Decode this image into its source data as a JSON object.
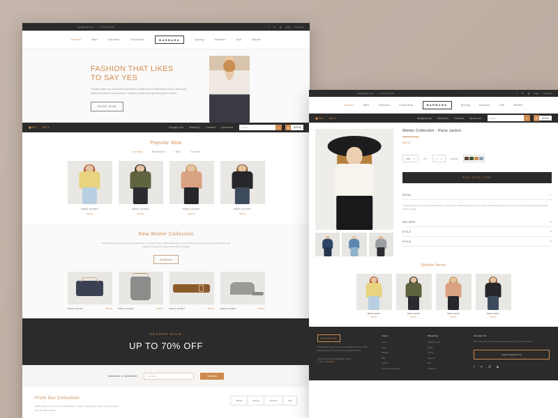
{
  "header": {
    "email": "gaia@zaid.com",
    "phone": "+1 212 475 00",
    "social_icons": [
      "facebook-icon",
      "twitter-icon",
      "google-plus-icon"
    ],
    "login": "Login",
    "register": "Register",
    "logo": "BARBARA",
    "nav": [
      {
        "label": "Women",
        "active": true
      },
      {
        "label": "Men",
        "active": false
      },
      {
        "label": "Children",
        "active": false
      },
      {
        "label": "Collection",
        "active": false
      },
      {
        "label": "Spring",
        "active": false
      },
      {
        "label": "Summer",
        "active": false
      },
      {
        "label": "Fall",
        "active": false
      },
      {
        "label": "Winter",
        "active": false
      }
    ],
    "language": "EN",
    "currency": "USD",
    "util_links": [
      "Shopping Cart",
      "Wishlist (0)",
      "Checkout",
      "My Account"
    ],
    "search_placeholder": "Search",
    "cart_total": "$79.00"
  },
  "hero": {
    "title_line1": "FASHION THAT LIKES",
    "title_line2": "TO SAY YES",
    "paragraph": "Curabitur neque erat, accumsan id imperdiet et, porttitor at sem. Pellentesque dum sit amet quam vehicula elementum sed sit amet dui. Vivamus suscipit tortor eget felis porttitor volutpat.",
    "cta": "SHOP NOW"
  },
  "popular": {
    "heading": "Popular Now",
    "filters": [
      {
        "label": "Trending",
        "active": true
      },
      {
        "label": "Bestsellers",
        "active": false
      },
      {
        "label": "New",
        "active": false
      },
      {
        "label": "On Sale",
        "active": false
      }
    ],
    "products": [
      {
        "name": "PARIS JACKET",
        "price": "$65.99",
        "top": "#e8d37f",
        "bottom": "#b7cfe0",
        "hair": "#b5542a"
      },
      {
        "name": "PARIS JACKET",
        "price": "$65.99",
        "top": "#5f6340",
        "bottom": "#2c2c30",
        "hair": "#3a2c23"
      },
      {
        "name": "PARIS JACKET",
        "price": "$69.99",
        "top": "#d9a283",
        "bottom": "#26262b",
        "hair": "#c79a58"
      },
      {
        "name": "PARIS JACKET",
        "price": "$65.99",
        "top": "#26262b",
        "bottom": "#3e4a5e",
        "hair": "#8f5c32"
      }
    ]
  },
  "winter": {
    "heading": "New Winter Collection",
    "paragraph": "Curabitur neque erat, accumsan id imperdiet et, porttitor at sem. Pellentesque dum sit amet quam vehicula elementum sed sit amet dui. Vivamus suscipit tortor eget felis porttitor volutpat.",
    "cta": "All collection",
    "accessories": [
      {
        "name": "PARIS JACKET",
        "price": "$65.99",
        "icon": "handbag-icon"
      },
      {
        "name": "PARIS JACKET",
        "price": "$65.99",
        "icon": "backpack-icon"
      },
      {
        "name": "PARIS JACKET",
        "price": "$65.99",
        "icon": "belt-icon"
      },
      {
        "name": "PARIS JACKET",
        "price": "$65.99",
        "icon": "cap-icon"
      }
    ]
  },
  "sale": {
    "kicker": "SEASON SALE",
    "headline": "UP TO 70% OFF"
  },
  "newsletter": {
    "label": "Subscribe to Newsletter",
    "placeholder": "Your Mail",
    "button": "Subscribe"
  },
  "collection": {
    "heading": "From Our Collection",
    "paragraph": "Pellentesque in ipsum id orci porta dapibus. Vivamus magna justo, lacinia eget consectetur sed, convallis at tellus.",
    "tabs": [
      "Winter",
      "Spring",
      "Summer",
      "Fall"
    ]
  },
  "pdp": {
    "title": "Winter Collection - Paris Jacket",
    "price": "$69.99",
    "size_label": "SIZE",
    "qty_label": "QTY",
    "qty_value": "1",
    "color_label": "COLOR",
    "swatches": [
      "#5c4634",
      "#3f5a2b",
      "#c98c4e",
      "#8ba2b8"
    ],
    "buy_button": "BUY THIS ITEM",
    "accordion": [
      {
        "title": "DETAIL",
        "state": "open",
        "glyph": "−"
      },
      {
        "title": "DELIVERY",
        "state": "closed",
        "glyph": "+"
      },
      {
        "title": "STYLE",
        "state": "closed",
        "glyph": "+"
      },
      {
        "title": "STYLE",
        "state": "closed",
        "glyph": "+"
      }
    ],
    "detail_body": "Curabitur neque erat, accumsan id imperdiet et, porttitor at sem. Pellentesque dum sit amet quam vehicula elementum sed sit amet dui. Vivamus suscipit tortor eget felis porttitor volutpat.",
    "thumbs": [
      "#2d4566",
      "#5b86ad",
      "#9a9ea2"
    ]
  },
  "similar": {
    "heading": "Similar Items",
    "products": [
      {
        "name": "PARIS JACKET",
        "price": "$65.99",
        "top": "#e8d37f",
        "bottom": "#b7cfe0",
        "hair": "#b5542a"
      },
      {
        "name": "PARIS JACKET",
        "price": "$65.99",
        "top": "#5f6340",
        "bottom": "#2c2c30",
        "hair": "#3a2c23"
      },
      {
        "name": "PARIS JACKET",
        "price": "$65.99",
        "top": "#d9a283",
        "bottom": "#26262b",
        "hair": "#c79a58"
      },
      {
        "name": "PARIS JACKET",
        "price": "$65.99",
        "top": "#26262b",
        "bottom": "#3e4a5e",
        "hair": "#8f5c32"
      }
    ]
  },
  "footer": {
    "logo": "BARBARA",
    "about": "Pellentesque in ipsum id orci porta dapibus. Vivamus magna justo, lacinia eget consectetur sed, convallis at tellus.",
    "credit_line1": "Created by Graphberry Belgrade Serbia",
    "credit_prefix": "© 2019 - ",
    "credit_link": "Graphberry",
    "links_heading": "Links",
    "links": [
      "Home",
      "Store",
      "Register",
      "FAQ",
      "Support",
      "Terms and Conditions"
    ],
    "shopping_heading": "Shopping",
    "shopping": [
      "Shopping Cart",
      "Winter",
      "Spring",
      "Summer",
      "Fall",
      "Collection"
    ],
    "contact_heading": "Contact Us",
    "contact_text": "Our store is only a visit and please life consulting for your online format",
    "contact_email": "graphberry@gmail.com",
    "social_icons": [
      "facebook-icon",
      "twitter-icon",
      "pinterest-icon",
      "dribbble-icon"
    ]
  },
  "colors": {
    "accent": "#cf8a4e",
    "dark": "#2b2b2b",
    "page_bg": "#bfb1a7"
  }
}
